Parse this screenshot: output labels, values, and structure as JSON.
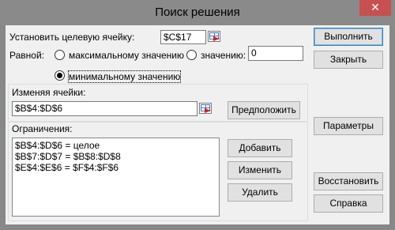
{
  "window": {
    "title": "Поиск решения",
    "close_label": "✕"
  },
  "objective": {
    "label": "Установить целевую ячейку:",
    "value": "$C$17"
  },
  "equal_to": {
    "label": "Равной:",
    "options": [
      {
        "label": "максимальному значению",
        "checked": false
      },
      {
        "label": "значению:",
        "checked": false
      },
      {
        "label": "минимальному значению",
        "checked": true
      }
    ],
    "value": "0"
  },
  "changing_cells": {
    "label": "Изменяя ячейки:",
    "value": "$B$4:$D$6",
    "guess_button": "Предположить"
  },
  "constraints": {
    "label": "Ограничения:",
    "items": [
      "$B$4:$D$6 = целое",
      "$B$7:$D$7 = $B$8:$D$8",
      "$E$4:$E$6 = $F$4:$F$6"
    ],
    "add_button": "Добавить",
    "change_button": "Изменить",
    "delete_button": "Удалить"
  },
  "side_buttons": {
    "solve": "Выполнить",
    "close": "Закрыть",
    "options": "Параметры",
    "reset": "Восстановить",
    "help": "Справка"
  }
}
